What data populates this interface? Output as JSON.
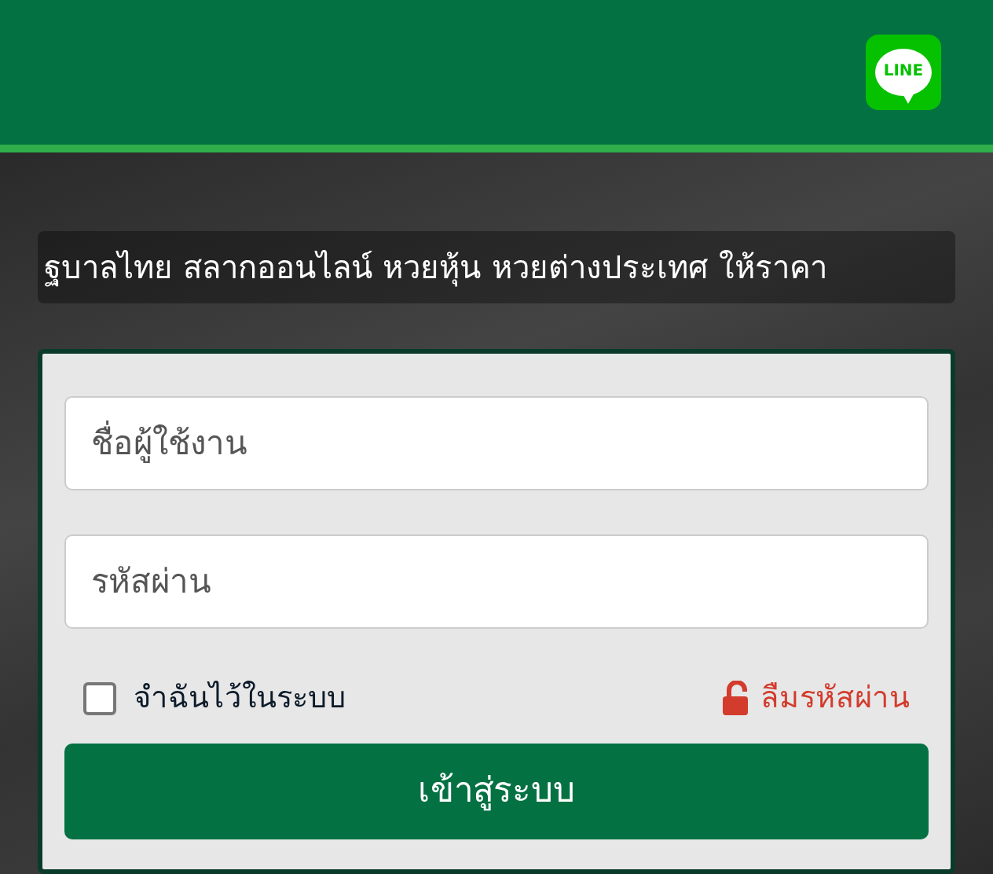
{
  "header": {
    "line_logo": "LINE"
  },
  "marquee": "ฐบาลไทย สลากออนไลน์ หวยหุ้น หวยต่างประเทศ ให้ราคา",
  "login": {
    "username": {
      "placeholder": "ชื่อผู้ใช้งาน"
    },
    "password": {
      "placeholder": "รหัสผ่าน"
    },
    "remember": {
      "label": "จำฉันไว้ในระบบ",
      "checked": false
    },
    "forgot": "ลืมรหัสผ่าน",
    "submit": "เข้าสู่ระบบ"
  }
}
